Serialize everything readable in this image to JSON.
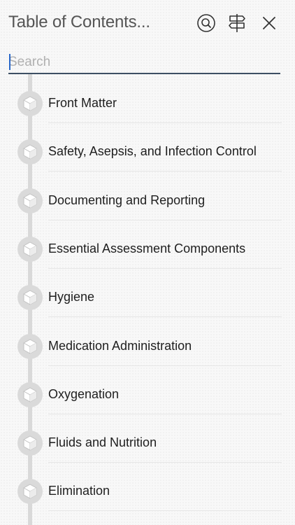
{
  "header": {
    "title": "Table of Contents...",
    "icons": [
      "search-icon",
      "signpost-icon",
      "close-icon"
    ]
  },
  "search": {
    "placeholder": "Search",
    "value": ""
  },
  "toc": {
    "node_icon": "book-cube-icon",
    "items": [
      {
        "label": "Front Matter"
      },
      {
        "label": "Safety, Asepsis, and Infection Control"
      },
      {
        "label": "Documenting and Reporting"
      },
      {
        "label": "Essential Assessment Components"
      },
      {
        "label": "Hygiene"
      },
      {
        "label": "Medication Administration"
      },
      {
        "label": "Oxygenation"
      },
      {
        "label": "Fluids and Nutrition"
      },
      {
        "label": "Elimination"
      }
    ]
  },
  "colors": {
    "accent_underline": "#3d4f63",
    "caret": "#2a68c9",
    "rail": "#d9d9d9",
    "node": "#dadada"
  }
}
